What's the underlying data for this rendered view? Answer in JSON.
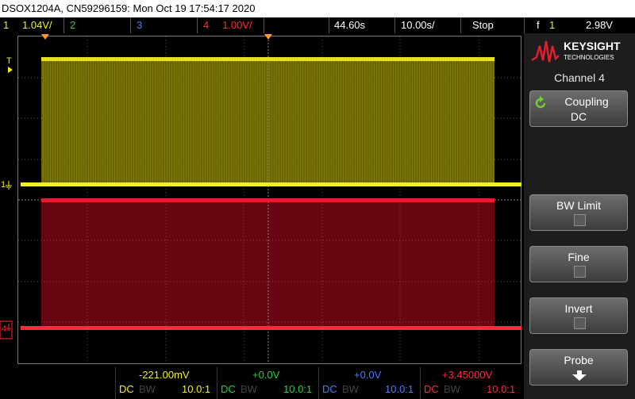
{
  "title": "DSOX1204A, CN59296159: Mon Oct 19 17:54:17 2020",
  "status": {
    "ch1_num": "1",
    "ch1_scale": "1.04V/",
    "ch2_num": "2",
    "ch3_num": "3",
    "ch4_num": "4",
    "ch4_scale": "1.00V/",
    "time_delay": "44.60s",
    "time_scale": "10.00s/",
    "run_state": "Stop",
    "trigger_symbol": "f",
    "trigger_source": "1",
    "trigger_level": "2.98V"
  },
  "markers": {
    "trigger_T": "T",
    "ch1_marker": "1",
    "ch4_marker": "4"
  },
  "softkeys": {
    "brand": "KEYSIGHT",
    "brand_sub": "TECHNOLOGIES",
    "menu_title": "Channel 4",
    "coupling_label": "Coupling",
    "coupling_value": "DC",
    "bw_limit_label": "BW Limit",
    "fine_label": "Fine",
    "invert_label": "Invert",
    "probe_label": "Probe"
  },
  "footer": {
    "ch1_offset": "-221.00mV",
    "ch2_offset": "+0.0V",
    "ch3_offset": "+0.0V",
    "ch4_offset": "+3.45000V",
    "ch1_coupling": "DC",
    "ch1_bw": "BW",
    "ch1_probe": "10.0:1",
    "ch2_coupling": "DC",
    "ch2_bw": "BW",
    "ch2_probe": "10.0:1",
    "ch3_coupling": "DC",
    "ch3_bw": "BW",
    "ch3_probe": "10.0:1",
    "ch4_coupling": "DC",
    "ch4_bw": "BW",
    "ch4_probe": "10.0:1"
  },
  "colors": {
    "ch1": "#f2ee26",
    "ch2": "#22d43a",
    "ch3": "#4a7cff",
    "ch4": "#ff2a3c",
    "ch1_fill": "#6a6604",
    "ch4_fill": "#680612",
    "orange": "#ff9a20"
  }
}
